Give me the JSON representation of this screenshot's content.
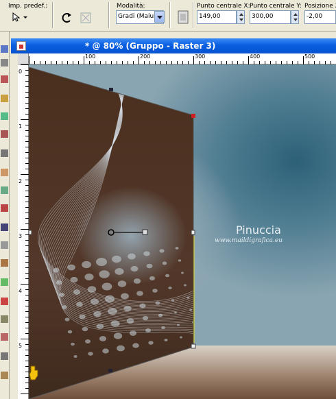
{
  "toolbar": {
    "preset_label": "Imp. predef.:",
    "mode_label": "Modalità:",
    "mode_value": "Gradi (Maiu:",
    "center_x_label": "Punto centrale X:",
    "center_x_value": "149,00",
    "center_y_label": "Punto centrale Y:",
    "center_y_value": "300,00",
    "position_x_label": "Posizione X",
    "position_x_value": "-2,00"
  },
  "document": {
    "title": "* @  80% (Gruppo - Raster 3)",
    "zoom": "80%"
  },
  "ruler": {
    "h_ticks": [
      "100",
      "200",
      "300",
      "400",
      "500"
    ],
    "v_ticks": [
      "0",
      "1",
      "2",
      "3",
      "4",
      "5"
    ]
  },
  "watermark": {
    "name": "Pinuccia",
    "site": "www.maildigrafica.eu"
  },
  "colors": {
    "titlebar": "#0a5fe0",
    "panel_brown": "#4a2f1e",
    "handle_red": "#cc2222"
  },
  "icons": [
    "preset-arrow-icon",
    "rotate-icon",
    "reset-icon",
    "deform-icon",
    "pick-tool-icon"
  ]
}
